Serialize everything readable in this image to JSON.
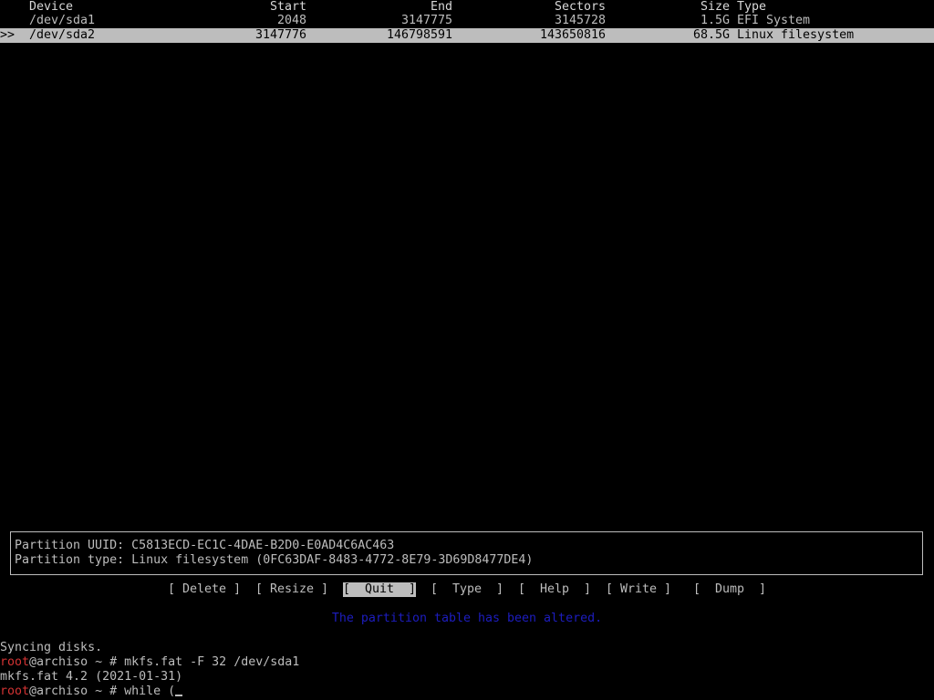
{
  "table": {
    "headers": {
      "device": "Device",
      "start": "Start",
      "end": "End",
      "sectors": "Sectors",
      "size": "Size",
      "type": "Type"
    },
    "rows": [
      {
        "marker": "",
        "device": "/dev/sda1",
        "start": "2048",
        "end": "3147775",
        "sectors": "3145728",
        "size": "1.5G",
        "type": "EFI System",
        "selected": false
      },
      {
        "marker": ">>",
        "device": "/dev/sda2",
        "start": "3147776",
        "end": "146798591",
        "sectors": "143650816",
        "size": "68.5G",
        "type": "Linux filesystem",
        "selected": true
      }
    ]
  },
  "info": {
    "uuid_label": "Partition UUID:",
    "uuid_value": "C5813ECD-EC1C-4DAE-B2D0-E0AD4C6AC463",
    "type_label": "Partition type:",
    "type_value": "Linux filesystem (0FC63DAF-8483-4772-8E79-3D69D8477DE4)"
  },
  "menu": {
    "delete": "[ Delete ]",
    "resize": "[ Resize ]",
    "quit": "[  Quit  ]",
    "type": "[  Type  ]",
    "help": "[  Help  ]",
    "write": "[ Write ]",
    "dump": "[  Dump  ]",
    "active": "quit"
  },
  "status_message": "The partition table has been altered.",
  "terminal": {
    "line1": "Syncing disks.",
    "prompt_user": "root",
    "prompt_rest": "@archiso ~ # ",
    "cmd1": "mkfs.fat -F 32 /dev/sda1",
    "line3": "mkfs.fat 4.2 (2021-01-31)",
    "cmd2": "while ("
  },
  "colors": {
    "foreground": "#bdbdbd",
    "background": "#000000",
    "selection_bg": "#bdbdbd",
    "status_blue": "#1d1dbf",
    "prompt_red": "#d23333"
  }
}
